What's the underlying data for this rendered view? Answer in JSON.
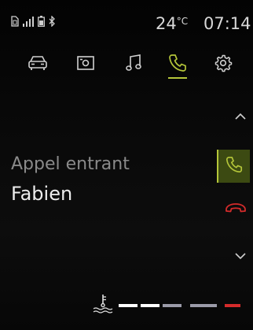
{
  "status_bar": {
    "icons": [
      "sim-card-icon",
      "signal-bars-icon",
      "battery-icon",
      "bluetooth-icon"
    ],
    "temperature_value": "24",
    "temperature_unit": "°C",
    "time": "07:14"
  },
  "tabs": [
    {
      "name": "car-icon",
      "active": false
    },
    {
      "name": "media-icon",
      "active": false
    },
    {
      "name": "music-note-icon",
      "active": false
    },
    {
      "name": "phone-icon",
      "active": true
    },
    {
      "name": "settings-gear-icon",
      "active": false
    }
  ],
  "call": {
    "title": "Appel entrant",
    "caller": "Fabien"
  },
  "colors": {
    "accent": "#b5c63a",
    "reject": "#d42b2b",
    "accept_bg": "#3c4a12"
  },
  "gauge": {
    "icon": "coolant-temperature-icon",
    "segments": [
      {
        "color": "#ffffff"
      },
      {
        "color": "#ffffff"
      },
      {
        "color": "#9a9aa8"
      },
      {
        "color": "#9a9aa8"
      },
      {
        "color": "#d42b2b"
      }
    ]
  }
}
